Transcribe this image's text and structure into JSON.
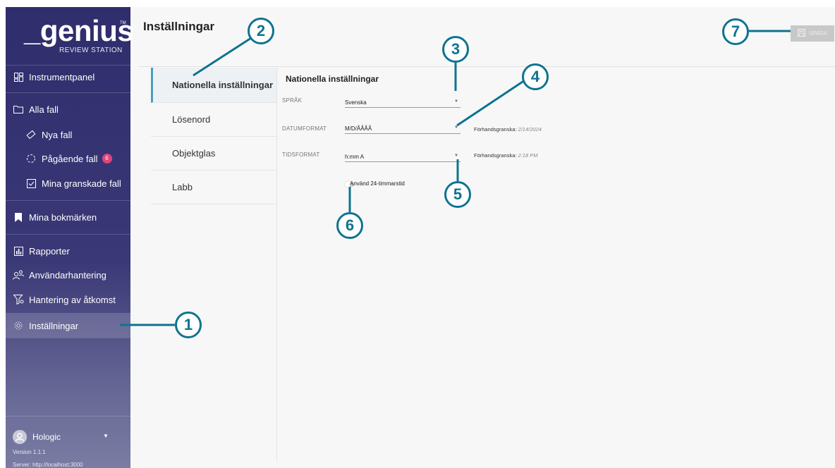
{
  "app": {
    "logo_text": "_genius",
    "logo_tm": "TM",
    "logo_subtitle": "REVIEW STATION"
  },
  "sidebar": {
    "items": [
      {
        "label": "Instrumentpanel",
        "icon": "dashboard-icon"
      },
      {
        "label": "Alla fall",
        "icon": "folder-icon"
      },
      {
        "label": "Nya fall",
        "icon": "slide-icon"
      },
      {
        "label": "Pågående fall",
        "icon": "progress-circle-icon",
        "badge": "6"
      },
      {
        "label": "Mina granskade fall",
        "icon": "checkbox-icon"
      },
      {
        "label": "Mina bokmärken",
        "icon": "bookmark-icon"
      },
      {
        "label": "Rapporter",
        "icon": "report-chart-icon"
      },
      {
        "label": "Användarhantering",
        "icon": "users-icon"
      },
      {
        "label": "Hantering av åtkomst",
        "icon": "access-filter-icon"
      },
      {
        "label": "Inställningar",
        "icon": "gear-icon"
      }
    ],
    "user": {
      "name": "Hologic"
    },
    "version": "Version 1.1.1",
    "server": "Server: http://localhost:3000"
  },
  "header": {
    "title": "Inställningar",
    "save_label": "SPARA"
  },
  "settings_nav": {
    "tabs": [
      "Nationella inställningar",
      "Lösenord",
      "Objektglas",
      "Labb"
    ]
  },
  "national": {
    "title": "Nationella inställningar",
    "language_label": "SPRÅK",
    "language_value": "Svenska",
    "date_label": "DATUMFORMAT",
    "date_value": "M/D/ÅÅÅÅ",
    "date_preview_label": "Förhandsgranska:",
    "date_preview_value": "2/14/2024",
    "time_label": "TIDSFORMAT",
    "time_value": "h:mm A",
    "time_preview_label": "Förhandsgranska:",
    "time_preview_value": "2:18 PM",
    "toggle_label": "Använd 24-timmarstid",
    "toggle_on": false
  },
  "callouts": [
    "1",
    "2",
    "3",
    "4",
    "5",
    "6",
    "7"
  ],
  "colors": {
    "sidebar": "#2f2d6b",
    "callout": "#0e7390",
    "active_tab_border": "#4a9ec0",
    "badge": "#e0457b"
  }
}
